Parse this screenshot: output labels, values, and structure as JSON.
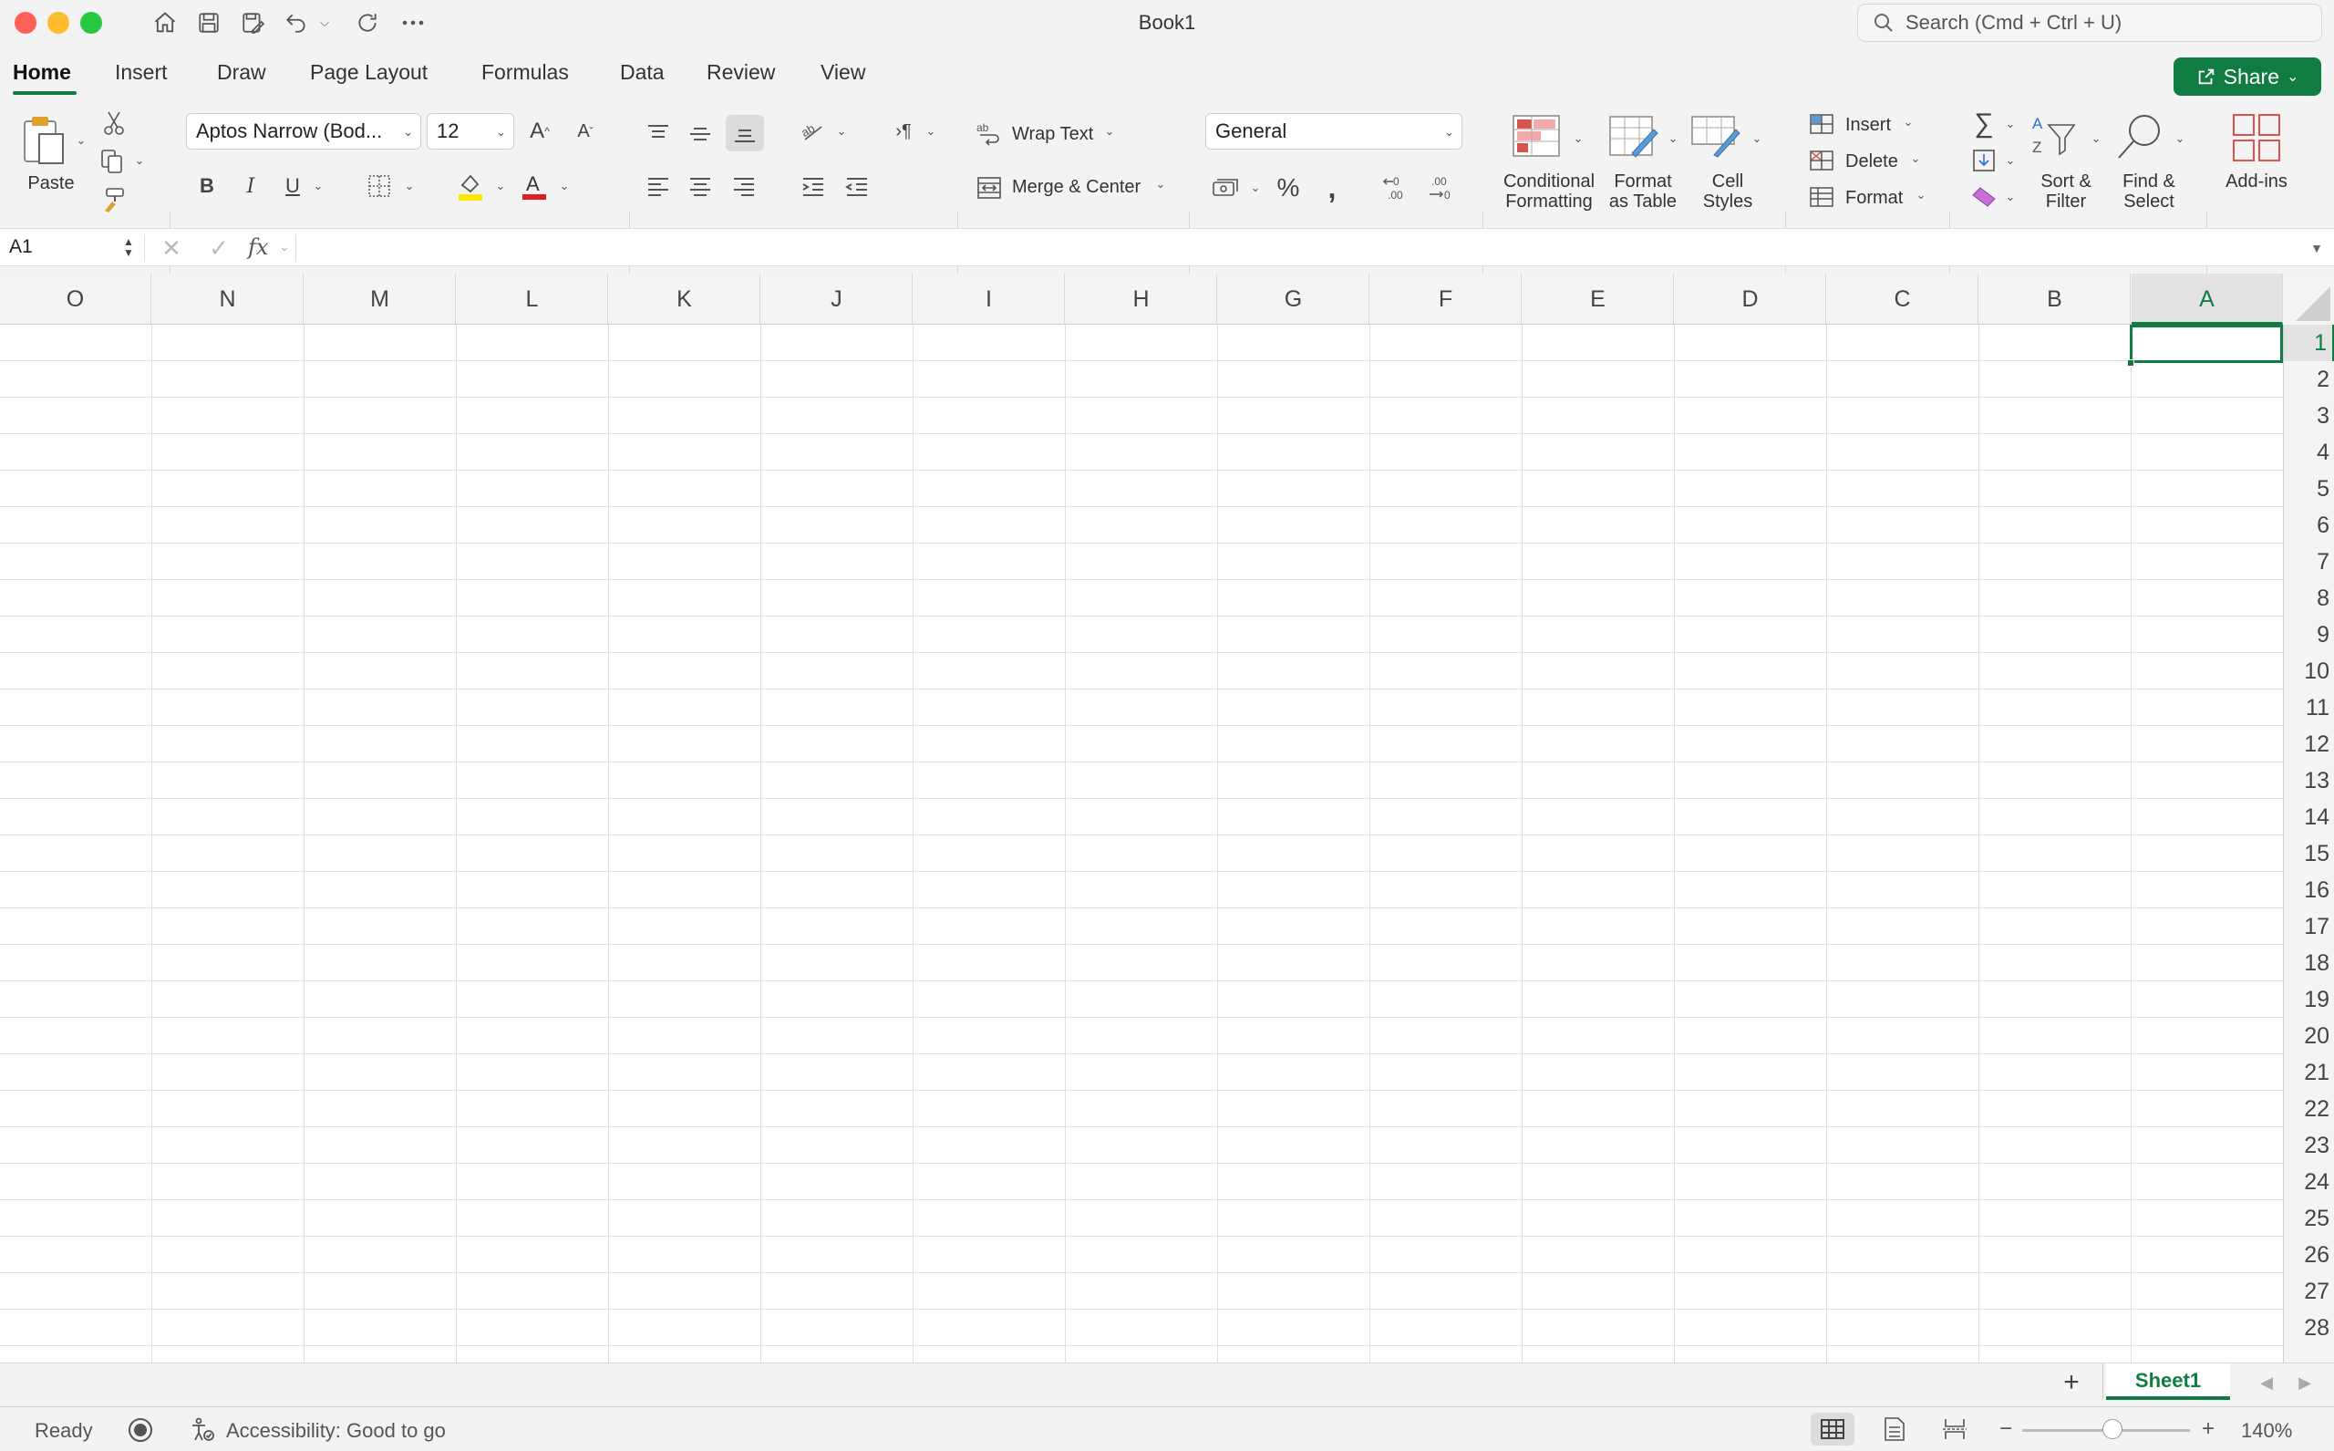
{
  "window": {
    "title": "Book1",
    "search_placeholder": "Search (Cmd + Ctrl + U)"
  },
  "tabs": [
    {
      "label": "Home",
      "active": true
    },
    {
      "label": "Insert"
    },
    {
      "label": "Draw"
    },
    {
      "label": "Page Layout"
    },
    {
      "label": "Formulas"
    },
    {
      "label": "Data"
    },
    {
      "label": "Review"
    },
    {
      "label": "View"
    }
  ],
  "share": {
    "label": "Share"
  },
  "ribbon": {
    "paste": "Paste",
    "font_name": "Aptos Narrow (Bod...",
    "font_size": "12",
    "bold": "B",
    "italic": "I",
    "underline": "U",
    "wrap_text": "Wrap Text",
    "merge_center": "Merge & Center",
    "number_format": "General",
    "percent": "%",
    "comma": ",",
    "conditional_formatting": [
      "Conditional",
      "Formatting"
    ],
    "format_as_table": [
      "Format",
      "as Table"
    ],
    "cell_styles": [
      "Cell",
      "Styles"
    ],
    "insert": "Insert",
    "delete": "Delete",
    "format": "Format",
    "sort_filter": [
      "Sort &",
      "Filter"
    ],
    "find_select": [
      "Find &",
      "Select"
    ],
    "addins": "Add-ins"
  },
  "formula_bar": {
    "name_box": "A1",
    "fx": "fx",
    "formula": ""
  },
  "columns": [
    "O",
    "N",
    "M",
    "L",
    "K",
    "J",
    "I",
    "H",
    "G",
    "F",
    "E",
    "D",
    "C",
    "B",
    "A"
  ],
  "selected_column": "A",
  "rows": [
    "1",
    "2",
    "3",
    "4",
    "5",
    "6",
    "7",
    "8",
    "9",
    "10",
    "11",
    "12",
    "13",
    "14",
    "15",
    "16",
    "17",
    "18",
    "19",
    "20",
    "21",
    "22",
    "23",
    "24",
    "25",
    "26",
    "27",
    "28"
  ],
  "selected_row": "1",
  "sheets": [
    {
      "label": "Sheet1",
      "active": true
    }
  ],
  "status": {
    "ready": "Ready",
    "accessibility": "Accessibility: Good to go",
    "zoom": "140%"
  },
  "colors": {
    "accent": "#107c41",
    "close": "#fe5f57",
    "minimize": "#febc2e",
    "maximize": "#28c840"
  }
}
